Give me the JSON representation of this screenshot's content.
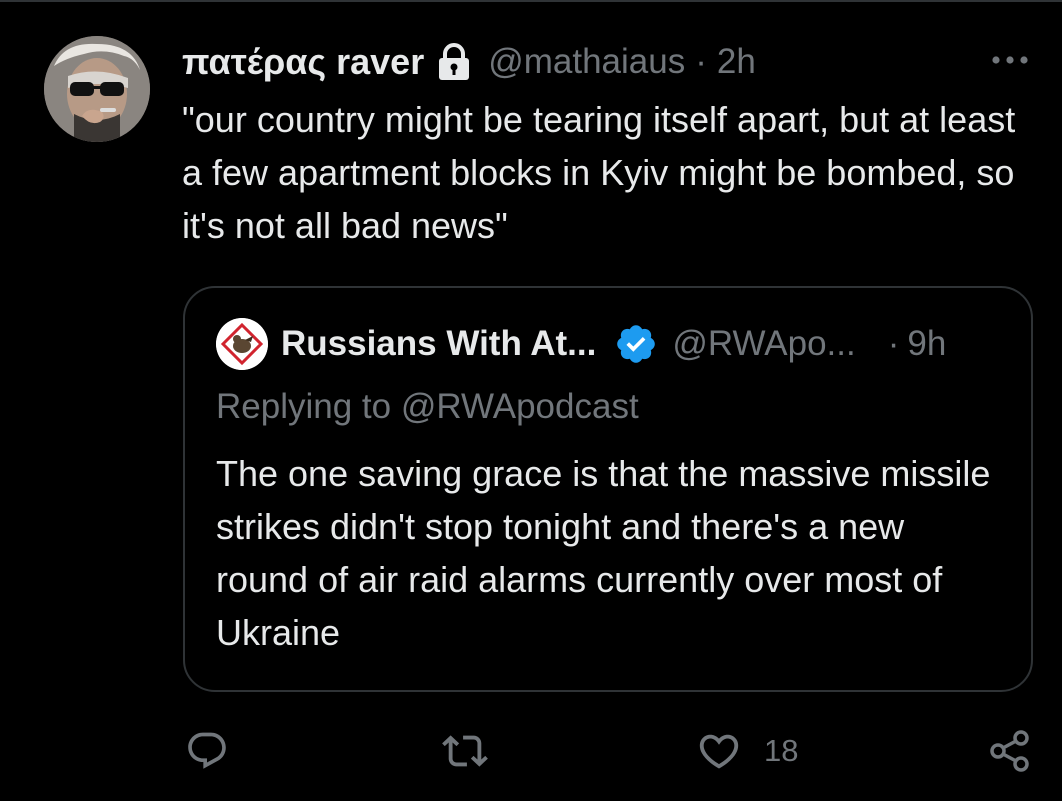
{
  "tweet": {
    "author": {
      "display_name": "πατέρας raver",
      "handle": "@mathaiaus",
      "avatar_icon": "user-avatar"
    },
    "separator": "·",
    "timestamp": "2h",
    "text": "\"our country might be tearing itself apart, but at least a few apartment blocks in Kyiv might be bombed, so it's not all bad news\"",
    "protected_icon": "lock-icon",
    "more_icon": "more-horizontal-icon"
  },
  "quoted_tweet": {
    "author": {
      "display_name": "Russians With At...",
      "handle": "@RWApo...",
      "verified_icon": "verified-badge-icon",
      "avatar_icon": "rwa-logo"
    },
    "separator": "·",
    "timestamp": "9h",
    "replying_to": "Replying to @RWApodcast",
    "text": "The one saving grace is that the massive missile strikes didn't stop tonight and there's a new round of air raid alarms currently over most of Ukraine"
  },
  "actions": {
    "reply_icon": "reply-icon",
    "retweet_icon": "retweet-icon",
    "like_icon": "heart-icon",
    "like_count": "18",
    "share_icon": "share-icon"
  },
  "colors": {
    "background": "#000000",
    "primary_text": "#e7e9ea",
    "secondary_text": "#71767b",
    "border": "#2f3336",
    "verified_blue": "#1d9bf0"
  }
}
